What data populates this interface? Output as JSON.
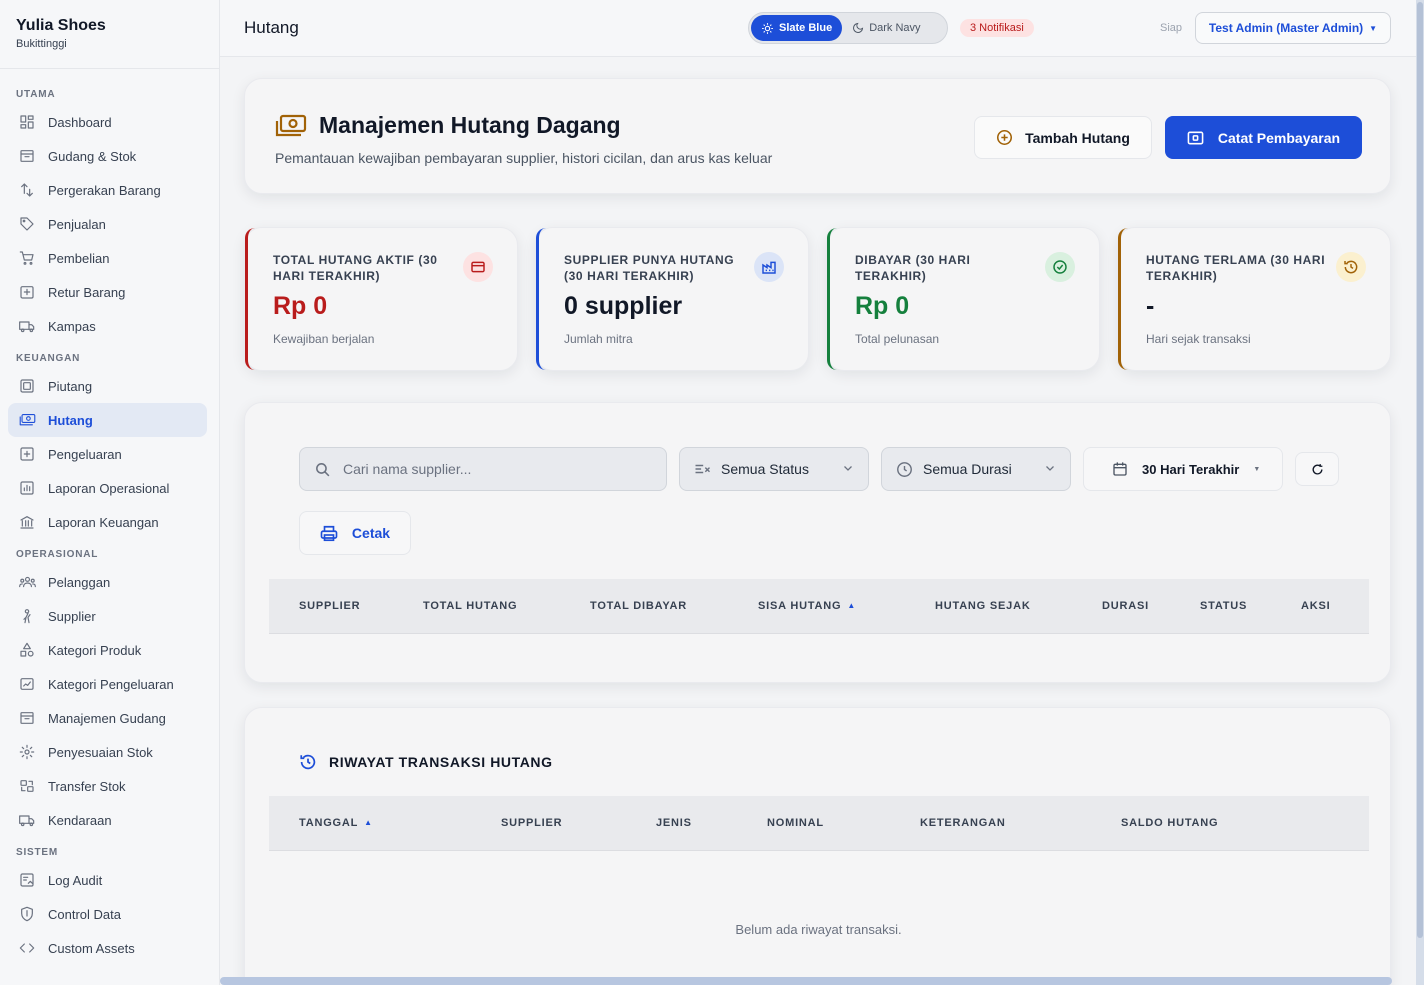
{
  "brand": {
    "name": "Yulia Shoes",
    "location": "Bukittinggi"
  },
  "sidebar": {
    "sections": [
      {
        "title": "UTAMA",
        "items": [
          {
            "label": "Dashboard",
            "icon": "dashboard-icon"
          },
          {
            "label": "Gudang & Stok",
            "icon": "warehouse-icon"
          },
          {
            "label": "Pergerakan Barang",
            "icon": "transfer-arrows-icon"
          },
          {
            "label": "Penjualan",
            "icon": "tag-icon"
          },
          {
            "label": "Pembelian",
            "icon": "cart-icon"
          },
          {
            "label": "Retur Barang",
            "icon": "return-icon"
          },
          {
            "label": "Kampas",
            "icon": "truck-icon"
          }
        ]
      },
      {
        "title": "KEUANGAN",
        "items": [
          {
            "label": "Piutang",
            "icon": "receivable-icon"
          },
          {
            "label": "Hutang",
            "icon": "money-icon",
            "active": true
          },
          {
            "label": "Pengeluaran",
            "icon": "expense-icon"
          },
          {
            "label": "Laporan Operasional",
            "icon": "report-icon"
          },
          {
            "label": "Laporan Keuangan",
            "icon": "bank-icon"
          }
        ]
      },
      {
        "title": "OPERASIONAL",
        "items": [
          {
            "label": "Pelanggan",
            "icon": "users-icon"
          },
          {
            "label": "Supplier",
            "icon": "person-icon"
          },
          {
            "label": "Kategori Produk",
            "icon": "shapes-icon"
          },
          {
            "label": "Kategori Pengeluaran",
            "icon": "chart-icon"
          },
          {
            "label": "Manajemen Gudang",
            "icon": "warehouse-icon"
          },
          {
            "label": "Penyesuaian Stok",
            "icon": "gear-icon"
          },
          {
            "label": "Transfer Stok",
            "icon": "swap-icon"
          },
          {
            "label": "Kendaraan",
            "icon": "truck-icon"
          }
        ]
      },
      {
        "title": "SISTEM",
        "items": [
          {
            "label": "Log Audit",
            "icon": "audit-icon"
          },
          {
            "label": "Control Data",
            "icon": "shield-icon"
          },
          {
            "label": "Custom Assets",
            "icon": "code-icon"
          }
        ]
      }
    ]
  },
  "topbar": {
    "title": "Hutang",
    "theme_light": "Slate Blue",
    "theme_dark": "Dark Navy",
    "notifications": "3 Notifikasi",
    "status": "Siap",
    "user": "Test Admin (Master Admin)"
  },
  "hero": {
    "title": "Manajemen Hutang Dagang",
    "subtitle": "Pemantauan kewajiban pembayaran supplier, histori cicilan, dan arus kas keluar",
    "add_label": "Tambah Hutang",
    "pay_label": "Catat Pembayaran"
  },
  "stats": [
    {
      "label": "TOTAL HUTANG AKTIF (30 HARI TERAKHIR)",
      "value": "Rp 0",
      "foot": "Kewajiban berjalan",
      "color": "#b91c1c",
      "icon": "card-icon"
    },
    {
      "label": "SUPPLIER PUNYA HUTANG (30 HARI TERAKHIR)",
      "value": "0 supplier",
      "foot": "Jumlah mitra",
      "color": "#1d4ed8",
      "icon": "factory-icon"
    },
    {
      "label": "DIBAYAR (30 HARI TERAKHIR)",
      "value": "Rp 0",
      "foot": "Total pelunasan",
      "color": "#15803d",
      "icon": "check-circle-icon"
    },
    {
      "label": "HUTANG TERLAMA (30 HARI TERAKHIR)",
      "value": "-",
      "foot": "Hari sejak transaksi",
      "color": "#a16207",
      "icon": "history-icon"
    }
  ],
  "filters": {
    "search_placeholder": "Cari nama supplier...",
    "status": "Semua Status",
    "duration": "Semua Durasi",
    "date_range": "30 Hari Terakhir",
    "print_label": "Cetak"
  },
  "debt_table": {
    "columns": [
      "SUPPLIER",
      "TOTAL HUTANG",
      "TOTAL DIBAYAR",
      "SISA HUTANG",
      "HUTANG SEJAK",
      "DURASI",
      "STATUS",
      "AKSI"
    ]
  },
  "history": {
    "title": "RIWAYAT TRANSAKSI HUTANG",
    "columns": [
      "TANGGAL",
      "SUPPLIER",
      "JENIS",
      "NOMINAL",
      "KETERANGAN",
      "SALDO HUTANG"
    ],
    "empty": "Belum ada riwayat transaksi."
  },
  "colors": {
    "accent": "#1d4ed8",
    "danger": "#b91c1c",
    "success": "#15803d",
    "warning": "#a16207"
  }
}
